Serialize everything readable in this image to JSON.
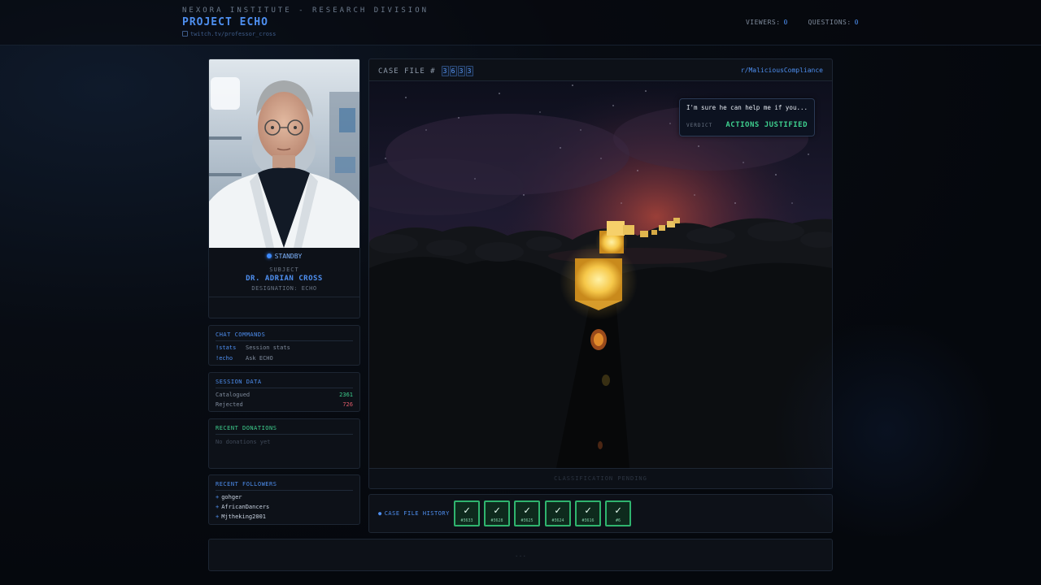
{
  "header": {
    "org": "NEXORA INSTITUTE - RESEARCH DIVISION",
    "project": "PROJECT ECHO",
    "channel": "twitch.tv/professor_cross",
    "viewers_label": "VIEWERS:",
    "viewers": "0",
    "questions_label": "QUESTIONS:",
    "questions": "0"
  },
  "profile": {
    "status": "STANDBY",
    "subject_label": "SUBJECT",
    "name": "DR. ADRIAN CROSS",
    "designation": "DESIGNATION: ECHO"
  },
  "commands": {
    "title": "CHAT COMMANDS",
    "items": [
      {
        "cmd": "!stats",
        "desc": "Session stats"
      },
      {
        "cmd": "!echo",
        "desc": "Ask ECHO"
      }
    ]
  },
  "session": {
    "title": "SESSION DATA",
    "catalogued_label": "Catalogued",
    "catalogued": "2361",
    "rejected_label": "Rejected",
    "rejected": "726"
  },
  "donations": {
    "title": "RECENT DONATIONS",
    "empty": "No donations yet"
  },
  "followers": {
    "title": "RECENT FOLLOWERS",
    "items": [
      "gohger",
      "AfricanDancers",
      "Mjtheking2001"
    ]
  },
  "case": {
    "label": "CASE FILE #",
    "digits": [
      "3",
      "6",
      "3",
      "3"
    ],
    "subreddit": "r/MaliciousCompliance",
    "question": "I'm sure he can help me if you...",
    "verdict_label": "VERDICT",
    "verdict": "ACTIONS JUSTIFIED",
    "footer": "CLASSIFICATION PENDING"
  },
  "history": {
    "label": "CASE FILE HISTORY",
    "cards": [
      {
        "mark": "✓",
        "id": "#3633"
      },
      {
        "mark": "✓",
        "id": "#3628"
      },
      {
        "mark": "✓",
        "id": "#3625"
      },
      {
        "mark": "✓",
        "id": "#3624"
      },
      {
        "mark": "✓",
        "id": "#3616"
      },
      {
        "mark": "✓",
        "id": "#6"
      }
    ]
  },
  "bottom": {
    "dots": "..."
  },
  "colors": {
    "accent": "#4e8ff0",
    "success": "#3ecf8e",
    "danger": "#e05c6a",
    "background": "#06090f"
  }
}
